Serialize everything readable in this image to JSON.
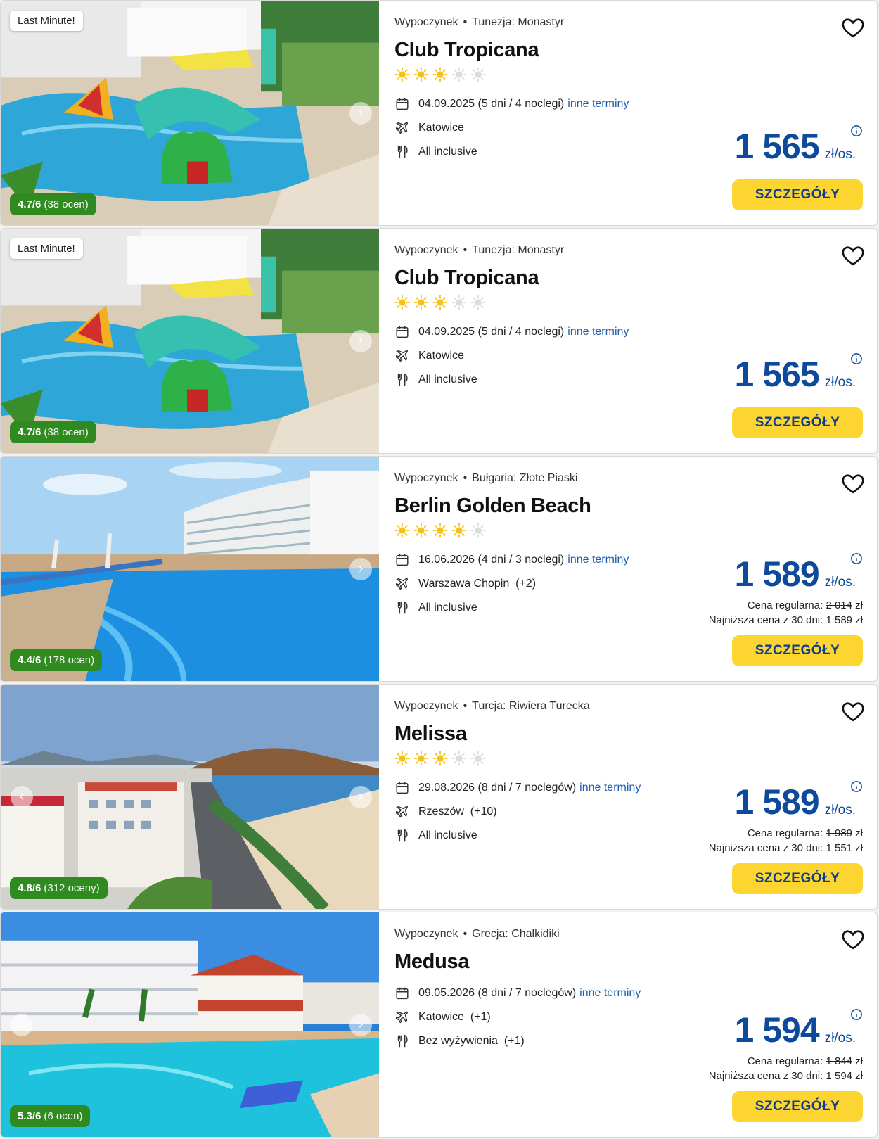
{
  "colors": {
    "accent": "#0e4a9c",
    "button": "#fcd530",
    "rating": "#2f8a1f",
    "link": "#1f5fb0"
  },
  "offers": [
    {
      "last_minute": "Last Minute!",
      "rating": "4.7/6",
      "rating_count": "(38 ocen)",
      "category": "Wypoczynek",
      "location": "Tunezja: Monastyr",
      "name": "Club Tropicana",
      "stars": 3,
      "date": "04.09.2025 (5 dni / 4 noclegi)",
      "other_dates": "inne terminy",
      "departure": "Katowice",
      "board": "All inclusive",
      "price": "1 565",
      "unit": "zł/os.",
      "button": "SZCZEGÓŁY",
      "scene": "pool"
    },
    {
      "last_minute": "Last Minute!",
      "rating": "4.7/6",
      "rating_count": "(38 ocen)",
      "category": "Wypoczynek",
      "location": "Tunezja: Monastyr",
      "name": "Club Tropicana",
      "stars": 3,
      "date": "04.09.2025 (5 dni / 4 noclegi)",
      "other_dates": "inne terminy",
      "departure": "Katowice",
      "board": "All inclusive",
      "price": "1 565",
      "unit": "zł/os.",
      "button": "SZCZEGÓŁY",
      "scene": "pool"
    },
    {
      "rating": "4.4/6",
      "rating_count": "(178 ocen)",
      "category": "Wypoczynek",
      "location": "Bułgaria: Złote Piaski",
      "name": "Berlin Golden Beach",
      "stars": 4,
      "date": "16.06.2026 (4 dni / 3 noclegi)",
      "other_dates": "inne terminy",
      "departure": "Warszawa Chopin  (+2)",
      "board": "All inclusive",
      "price": "1 589",
      "unit": "zł/os.",
      "regular_label": "Cena regularna: ",
      "regular_price": "2 014",
      "regular_currency": " zł",
      "lowest": "Najniższa cena z 30 dni: 1 589 zł",
      "button": "SZCZEGÓŁY",
      "scene": "hotelpool"
    },
    {
      "rating": "4.8/6",
      "rating_count": "(312 oceny)",
      "category": "Wypoczynek",
      "location": "Turcja: Riwiera Turecka",
      "name": "Melissa",
      "stars": 3,
      "date": "29.08.2026 (8 dni / 7 noclegów)",
      "other_dates": "inne terminy",
      "departure": "Rzeszów  (+10)",
      "board": "All inclusive",
      "price": "1 589",
      "unit": "zł/os.",
      "regular_label": "Cena regularna: ",
      "regular_price": "1 989",
      "regular_currency": " zł",
      "lowest": "Najniższa cena z 30 dni: 1 551 zł",
      "button": "SZCZEGÓŁY",
      "scene": "city"
    },
    {
      "rating": "5.3/6",
      "rating_count": "(6 ocen)",
      "category": "Wypoczynek",
      "location": "Grecja: Chalkidiki",
      "name": "Medusa",
      "stars": 0,
      "date": "09.05.2026 (8 dni / 7 noclegów)",
      "other_dates": "inne terminy",
      "departure": "Katowice  (+1)",
      "board": "Bez wyżywienia  (+1)",
      "price": "1 594",
      "unit": "zł/os.",
      "regular_label": "Cena regularna: ",
      "regular_price": "1 844",
      "regular_currency": " zł",
      "lowest": "Najniższa cena z 30 dni: 1 594 zł",
      "button": "SZCZEGÓŁY",
      "scene": "greek"
    }
  ]
}
